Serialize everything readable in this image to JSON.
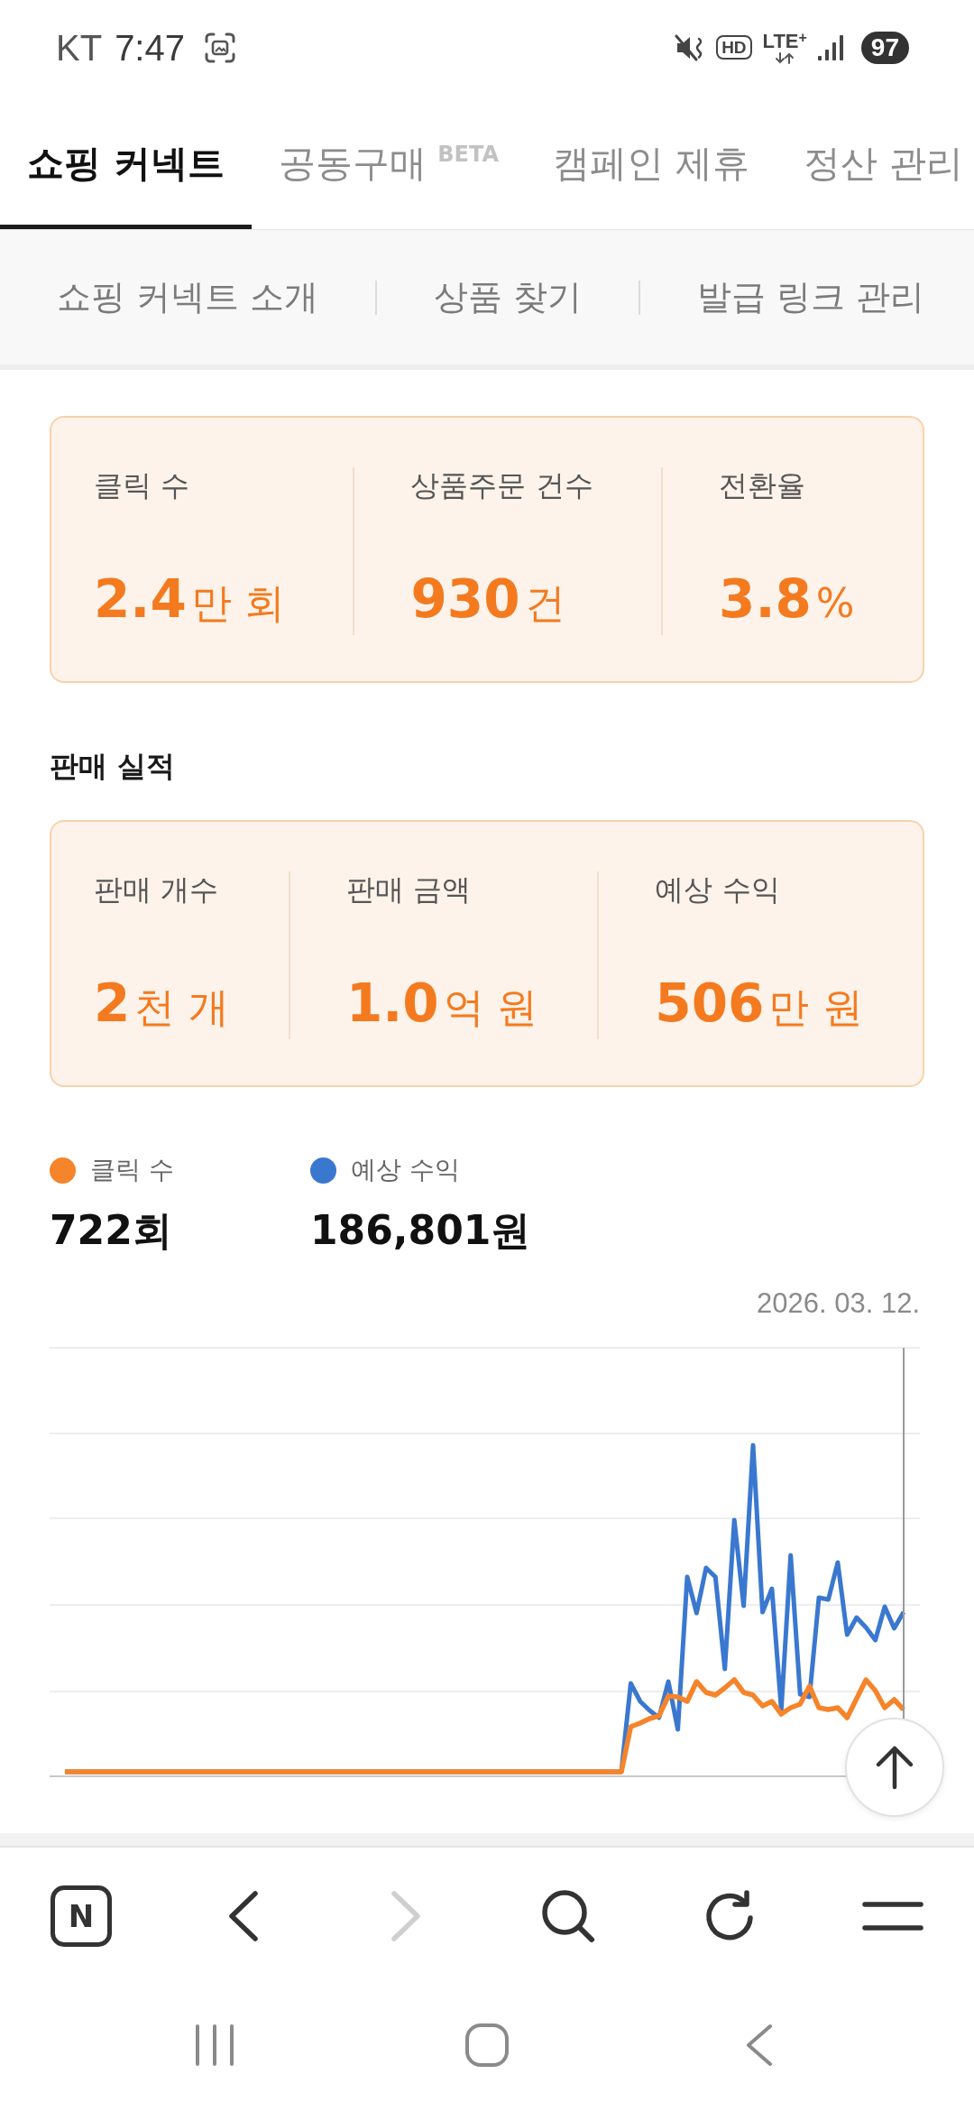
{
  "status_bar": {
    "carrier": "KT",
    "time": "7:47",
    "hd": "HD",
    "network": "LTE$^{+}$",
    "battery": "97"
  },
  "tabs": [
    {
      "label": "쇼핑 커넥트",
      "selected": true
    },
    {
      "label": "공동구매",
      "badge": "BETA",
      "selected": false
    },
    {
      "label": "캠페인 제휴",
      "selected": false
    },
    {
      "label": "정산 관리",
      "selected": false
    }
  ],
  "sub_tabs": [
    {
      "label": "쇼핑 커넥트 소개"
    },
    {
      "label": "상품 찾기"
    },
    {
      "label": "발급 링크 관리"
    }
  ],
  "traffic_stats": [
    {
      "label": "클릭 수",
      "value": "**2.4**만 회"
    },
    {
      "label": "상품주문 건수",
      "value": "**930**건"
    },
    {
      "label": "전환율",
      "value": "**3.8**%"
    }
  ],
  "sales": {
    "title": "판매 실적",
    "stats": [
      {
        "label": "판매 개수",
        "value": "**2**천 개"
      },
      {
        "label": "판매 금액",
        "value": "**1.0**억 원"
      },
      {
        "label": "예상 수익",
        "value": "**506**만 원"
      }
    ]
  },
  "chart": {
    "legend": [
      {
        "label": "클릭 수",
        "color": "#f5842a",
        "value": "722회"
      },
      {
        "label": "예상 수익",
        "color": "#3a78d0",
        "value": "186,801원"
      }
    ],
    "date": "2026. 03. 12."
  },
  "browser_toolbar": {
    "home": "N",
    "back": {
      "disabled": false
    },
    "forward": {
      "disabled": true
    }
  }
}
